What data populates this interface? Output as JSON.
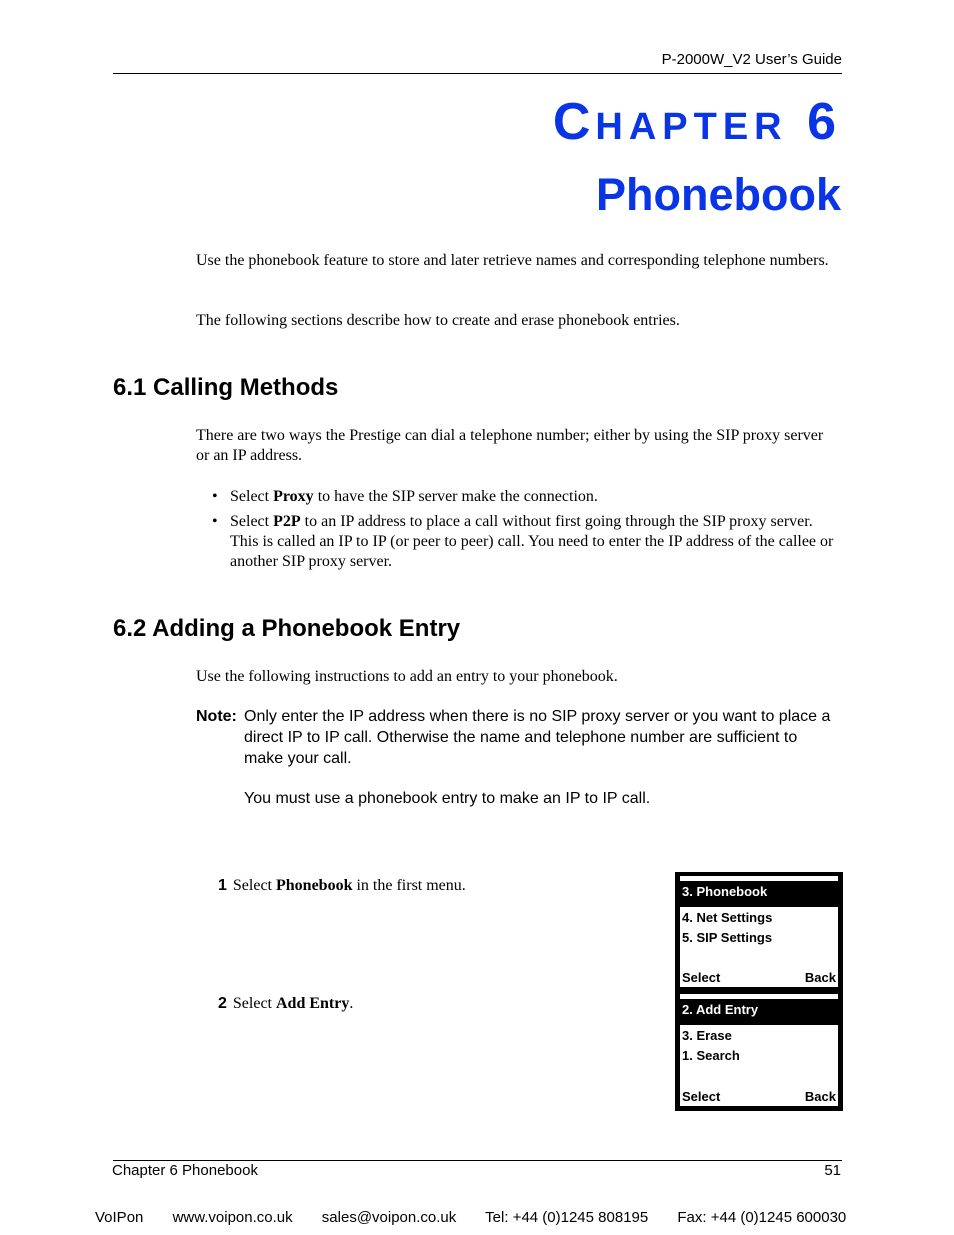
{
  "header": {
    "guide_title": "P-2000W_V2 User’s Guide"
  },
  "chapter": {
    "label_initial": "C",
    "label_rest": "HAPTER",
    "number": "6",
    "title": "Phonebook"
  },
  "intro": {
    "p1": "Use the phonebook feature to store and later retrieve names and corresponding telephone numbers.",
    "p2": "The following sections describe how to create and erase phonebook entries."
  },
  "section1": {
    "heading": "6.1  Calling Methods",
    "paragraph": "There are two ways the Prestige can dial a telephone number; either by using the SIP proxy server or an IP address.",
    "bullets": [
      {
        "prefix": "Select ",
        "bold": "Proxy",
        "suffix": " to have the SIP server make the connection."
      },
      {
        "prefix": "Select ",
        "bold": "P2P",
        "suffix": " to an IP address to place a call without first going through the SIP proxy server. This is called an IP to IP (or peer to peer) call. You need to enter the IP address of the callee or another SIP proxy server."
      }
    ]
  },
  "section2": {
    "heading": "6.2  Adding a Phonebook Entry",
    "paragraph": "Use the following instructions to add an entry to your phonebook.",
    "note": {
      "label": "Note:",
      "text1": "Only enter the IP address when there is no SIP proxy server or you want to place a direct IP to IP call. Otherwise the name and telephone number are sufficient to make your call.",
      "text2": "You must use a phonebook entry to make an IP to IP call."
    },
    "steps": [
      {
        "num": "1",
        "prefix": "Select ",
        "bold": "Phonebook",
        "suffix": " in the first menu."
      },
      {
        "num": "2",
        "prefix": "Select ",
        "bold": "Add Entry",
        "suffix": "."
      }
    ]
  },
  "screens": [
    {
      "selected": "3. Phonebook",
      "items": [
        "4. Net Settings",
        "5. SIP Settings"
      ],
      "softkey_left": "Select",
      "softkey_right": "Back"
    },
    {
      "selected": "2. Add Entry",
      "items": [
        "3. Erase",
        "1. Search"
      ],
      "softkey_left": "Select",
      "softkey_right": "Back"
    }
  ],
  "footer": {
    "chapter_label": "Chapter 6 Phonebook",
    "page_number": "51",
    "contact": {
      "company": "VoIPon",
      "website": "www.voipon.co.uk",
      "email": "sales@voipon.co.uk",
      "tel": "Tel: +44 (0)1245 808195",
      "fax": "Fax: +44 (0)1245 600030"
    }
  }
}
